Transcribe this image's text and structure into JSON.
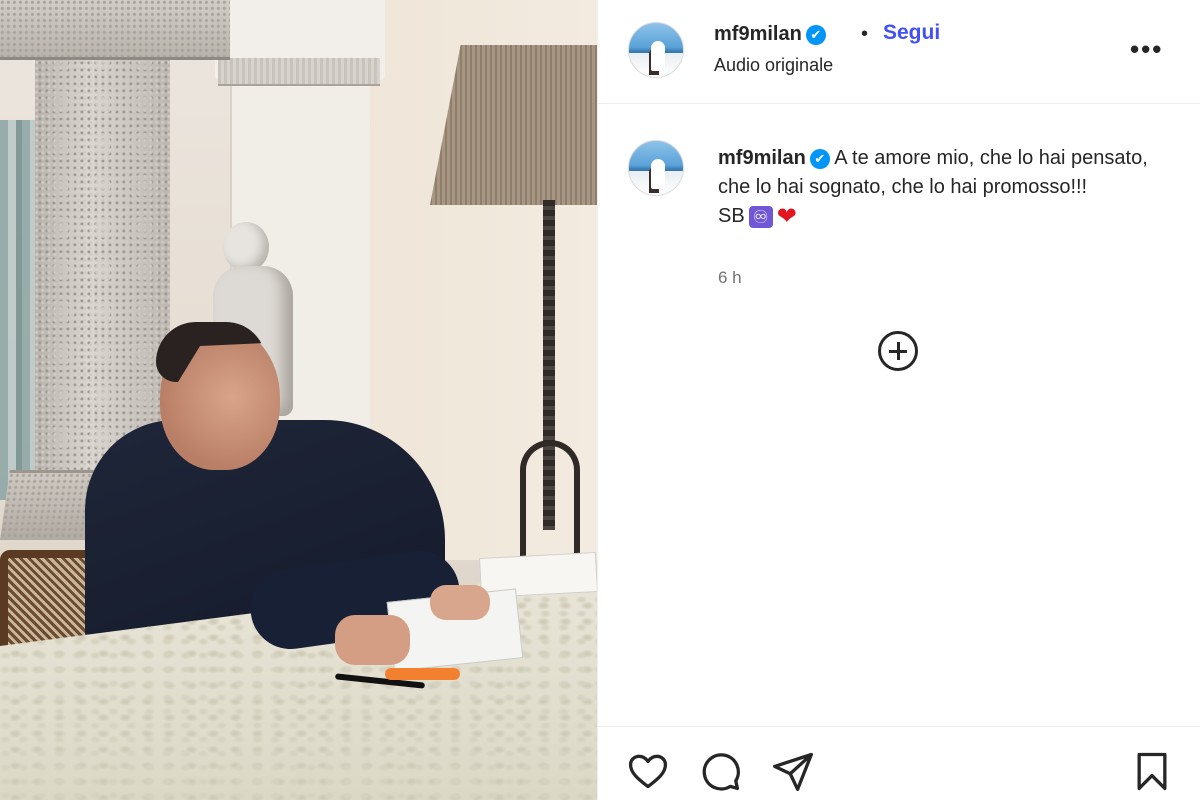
{
  "post": {
    "username": "mf9milan",
    "verified": "✔",
    "separator": "•",
    "follow_label": "Segui",
    "audio_label": "Audio originale",
    "more_label": "•••"
  },
  "caption": {
    "username": "mf9milan",
    "text": "A te amore mio, che lo hai pensato, che lo hai sognato, che lo hai promosso!!!",
    "signature": "SB",
    "infinity_emoji": "♾",
    "heart_emoji": "❤",
    "timestamp": "6 h"
  },
  "actions": {
    "like": "heart-icon",
    "comment": "comment-icon",
    "share": "share-icon",
    "save": "bookmark-icon"
  },
  "colors": {
    "accent": "#4150f7",
    "verified": "#0095f6",
    "text": "#262626",
    "muted": "#737373"
  }
}
